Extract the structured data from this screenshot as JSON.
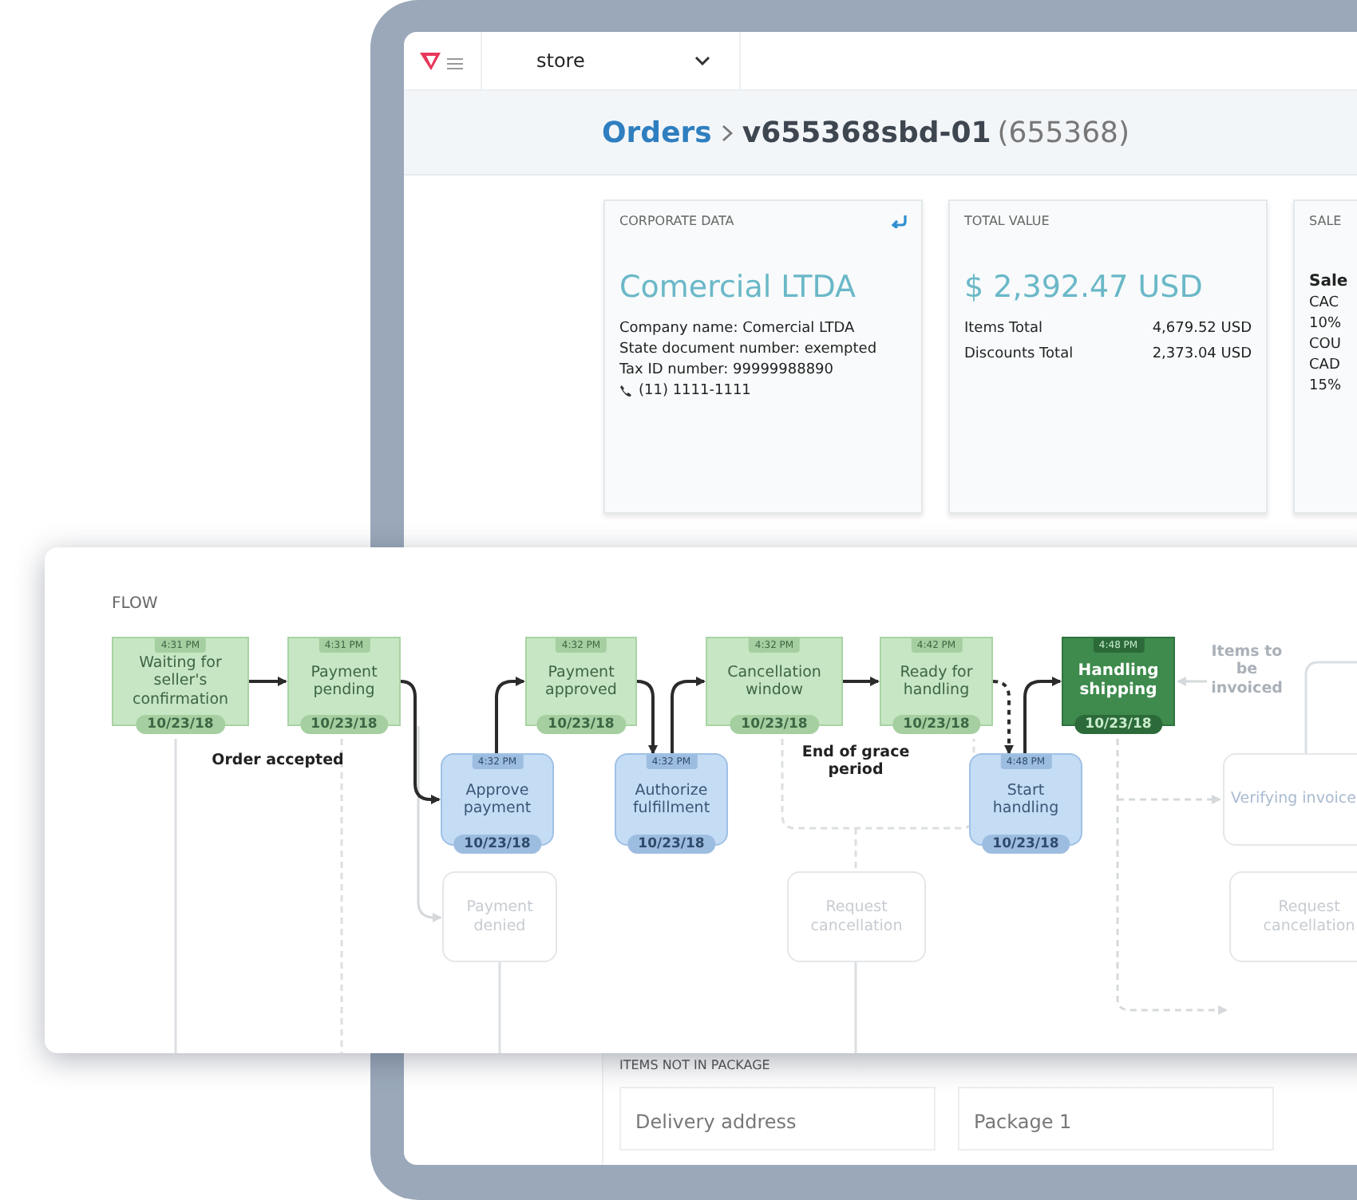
{
  "header": {
    "store_selector": {
      "value": "store"
    }
  },
  "breadcrumb": {
    "parent": "Orders",
    "current": "v655368sbd-01",
    "order_number": "(655368)"
  },
  "cards": [
    {
      "title": "CORPORATE DATA",
      "has_return_icon": true,
      "headline": "Comercial LTDA",
      "lines": [
        {
          "kind": "plain",
          "text": "Company name: Comercial LTDA"
        },
        {
          "kind": "plain",
          "text": "State document number: exempted"
        },
        {
          "kind": "plain",
          "text": "Tax ID number: 99999988890"
        },
        {
          "kind": "phone",
          "text": "(11) 1111-1111"
        }
      ]
    },
    {
      "title": "TOTAL VALUE",
      "headline": "$ 2,392.47 USD",
      "rows": [
        {
          "label": "Items Total",
          "value": "4,679.52 USD"
        },
        {
          "label": "Discounts Total",
          "value": "2,373.04 USD"
        }
      ]
    },
    {
      "title": "SALE",
      "lines": [
        {
          "kind": "strong",
          "text": "Sale"
        },
        {
          "kind": "plain",
          "text": "CAC"
        },
        {
          "kind": "plain",
          "text": "10%"
        },
        {
          "kind": "plain",
          "text": "COU"
        },
        {
          "kind": "plain",
          "text": "CAD"
        },
        {
          "kind": "plain",
          "text": "15%"
        }
      ]
    }
  ],
  "flow": {
    "title": "FLOW",
    "nodes": [
      {
        "kind": "done",
        "time": "4:31 PM",
        "label": "Waiting for seller's confirmation",
        "date": "10/23/18"
      },
      {
        "kind": "done",
        "time": "4:31 PM",
        "label": "Payment pending",
        "date": "10/23/18"
      },
      {
        "kind": "action",
        "time": "4:32 PM",
        "label": "Approve payment",
        "date": "10/23/18"
      },
      {
        "kind": "future",
        "label": "Payment denied"
      },
      {
        "kind": "done",
        "time": "4:32 PM",
        "label": "Payment approved",
        "date": "10/23/18"
      },
      {
        "kind": "action",
        "time": "4:32 PM",
        "label": "Authorize fulfillment",
        "date": "10/23/18"
      },
      {
        "kind": "done",
        "time": "4:32 PM",
        "label": "Cancellation window",
        "date": "10/23/18"
      },
      {
        "kind": "done",
        "time": "4:42 PM",
        "label": "Ready for handling",
        "date": "10/23/18"
      },
      {
        "kind": "future",
        "label": "Request cancellation"
      },
      {
        "kind": "action",
        "time": "4:48 PM",
        "label": "Start handling",
        "date": "10/23/18"
      },
      {
        "kind": "current",
        "time": "4:48 PM",
        "label": "Handling shipping",
        "date": "10/23/18"
      },
      {
        "kind": "future",
        "label": "Verifying invoice"
      },
      {
        "kind": "future",
        "label": "Request cancellation"
      }
    ],
    "annotations": [
      {
        "kind": "milestone",
        "text": "Order accepted"
      },
      {
        "kind": "milestone",
        "text": "End of grace period"
      },
      {
        "kind": "pending",
        "text": "Items to be invoiced"
      }
    ]
  },
  "items_section": {
    "title": "ITEMS NOT IN PACKAGE",
    "cards": [
      "Delivery address",
      "Package 1"
    ]
  }
}
